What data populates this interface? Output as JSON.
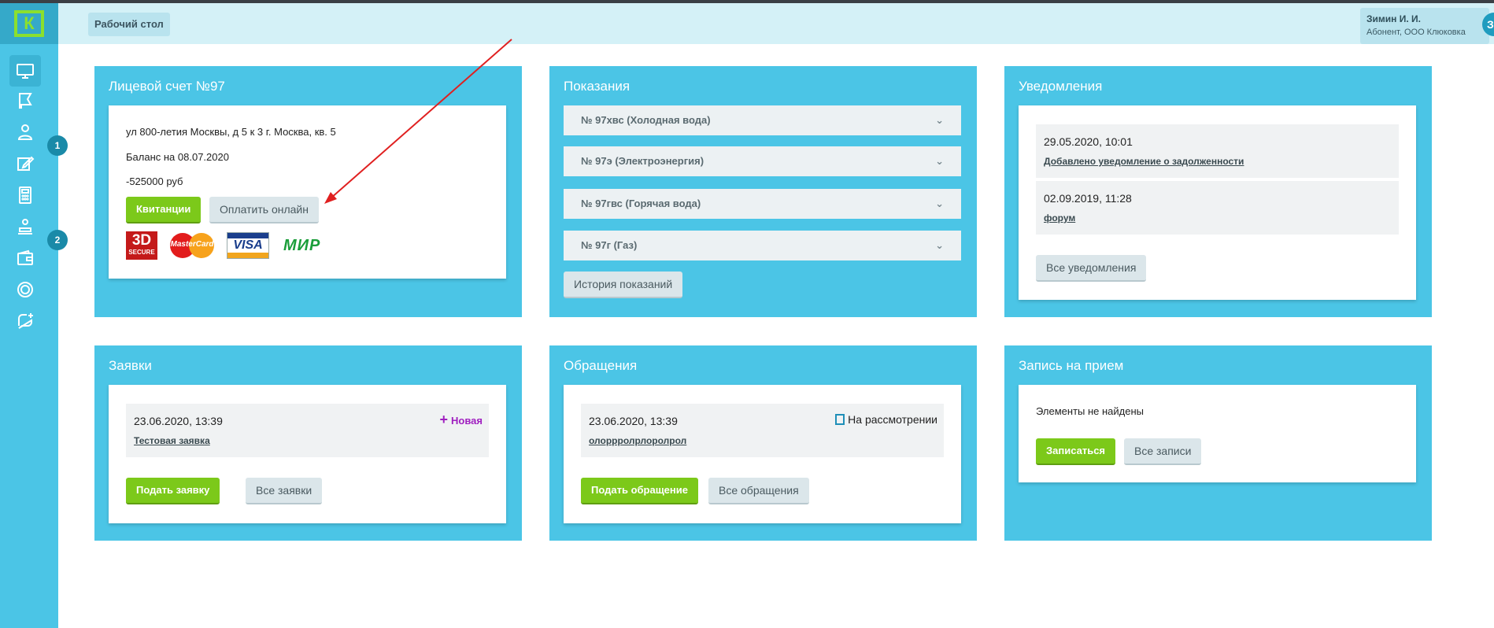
{
  "logo": {
    "letter": "К"
  },
  "header": {
    "breadcrumb": "Рабочий стол",
    "user_name": "Зимин И. И.",
    "user_role": "Абонент, ООО Клюковка",
    "user_initial": "З"
  },
  "sidebar": {
    "badges": {
      "b1": "1",
      "b2": "2"
    },
    "items": [
      "desktop-icon",
      "flag-icon",
      "people-icon",
      "edit-icon",
      "calculator-icon",
      "support-icon",
      "wallet-icon",
      "coin-icon",
      "chat-plus-icon"
    ]
  },
  "account": {
    "title": "Лицевой счет №97",
    "address": "ул 800-летия Москвы, д 5 к 3 г. Москва, кв. 5",
    "balance_label": "Баланс на 08.07.2020",
    "balance_value": "-525000 руб",
    "receipts_button": "Квитанции",
    "pay_button": "Оплатить онлайн",
    "pay_logos": {
      "secure_top": "3D",
      "secure_bottom": "SECURE",
      "mastercard": "MasterCard",
      "visa": "VISA",
      "mir": "МИР"
    }
  },
  "readings": {
    "title": "Показания",
    "items": [
      "№ 97хвс (Холодная вода)",
      "№ 97э (Электроэнергия)",
      "№ 97гвс (Горячая вода)",
      "№ 97г (Газ)"
    ],
    "history_button": "История показаний"
  },
  "notifications": {
    "title": "Уведомления",
    "items": [
      {
        "date": "29.05.2020, 10:01",
        "text": "Добавлено уведомление о задолженности"
      },
      {
        "date": "02.09.2019, 11:28",
        "text": "форум"
      }
    ],
    "all_button": "Все уведомления"
  },
  "requests": {
    "title": "Заявки",
    "item": {
      "date": "23.06.2020, 13:39",
      "text": "Тестовая заявка",
      "status": "Новая"
    },
    "submit_button": "Подать заявку",
    "all_button": "Все заявки",
    "status_color": "#a020c0"
  },
  "appeals": {
    "title": "Обращения",
    "item": {
      "date": "23.06.2020, 13:39",
      "text": "олоррролрлоролрол",
      "status": "На рассмотрении"
    },
    "submit_button": "Подать обращение",
    "all_button": "Все обращения"
  },
  "appointments": {
    "title": "Запись на прием",
    "empty_text": "Элементы не найдены",
    "book_button": "Записаться",
    "all_button": "Все записи"
  },
  "colors": {
    "sidebar": "#4bc5e6",
    "accent_green": "#7cc91a",
    "annotation_arrow": "#e02020"
  }
}
